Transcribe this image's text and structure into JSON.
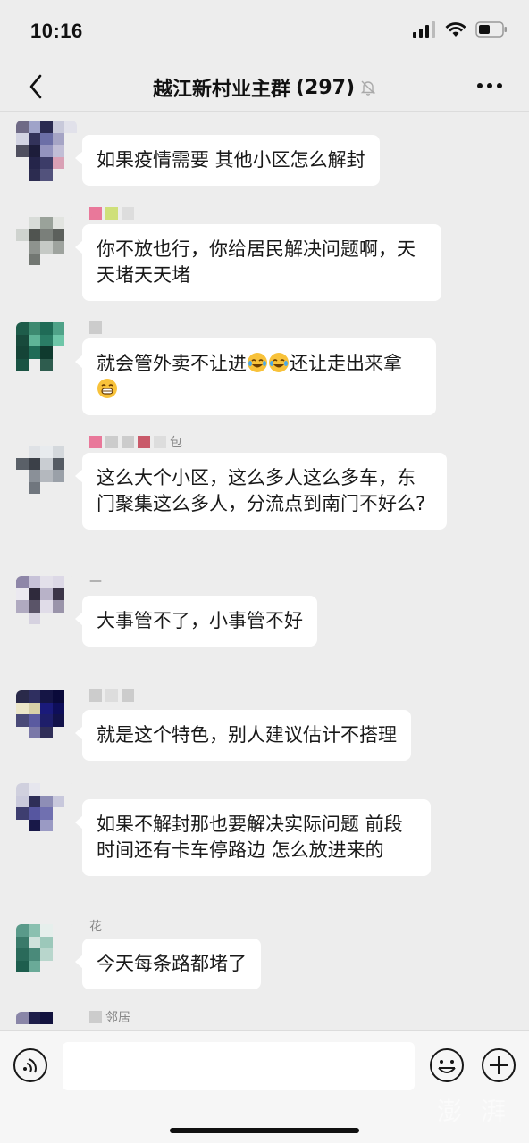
{
  "status_bar": {
    "time": "10:16"
  },
  "nav": {
    "title": "越江新村业主群",
    "member_count": "(297)"
  },
  "messages": [
    {
      "nickname": "",
      "text": "如果疫情需要 其他小区怎么解封"
    },
    {
      "nickname": "",
      "text": "你不放也行，你给居民解决问题啊，天天堵天天堵"
    },
    {
      "nickname": "",
      "text_before": "就会管外卖不让进",
      "text_middle": "还让走出来拿",
      "emojis": [
        "crying-laughing-emoji",
        "crying-laughing-emoji",
        "grinning-emoji"
      ]
    },
    {
      "nickname": "包",
      "text": "这么大个小区，这么多人这么多车，东门聚集这么多人，分流点到南门不好么?"
    },
    {
      "nickname": "",
      "text": "大事管不了，小事管不好"
    },
    {
      "nickname": "",
      "text": "就是这个特色，别人建议估计不搭理"
    },
    {
      "nickname": "",
      "text": "如果不解封那也要解决实际问题 前段时间还有卡车停路边 怎么放进来的"
    },
    {
      "nickname": "花",
      "text": "今天每条路都堵了"
    },
    {
      "nickname": "邻居",
      "text": ""
    }
  ],
  "input_bar": {
    "placeholder": "",
    "watermark": "澎 湃"
  },
  "colors": {
    "background": "#ededed",
    "bubble": "#ffffff",
    "text": "#191919",
    "nickname": "#888888"
  }
}
